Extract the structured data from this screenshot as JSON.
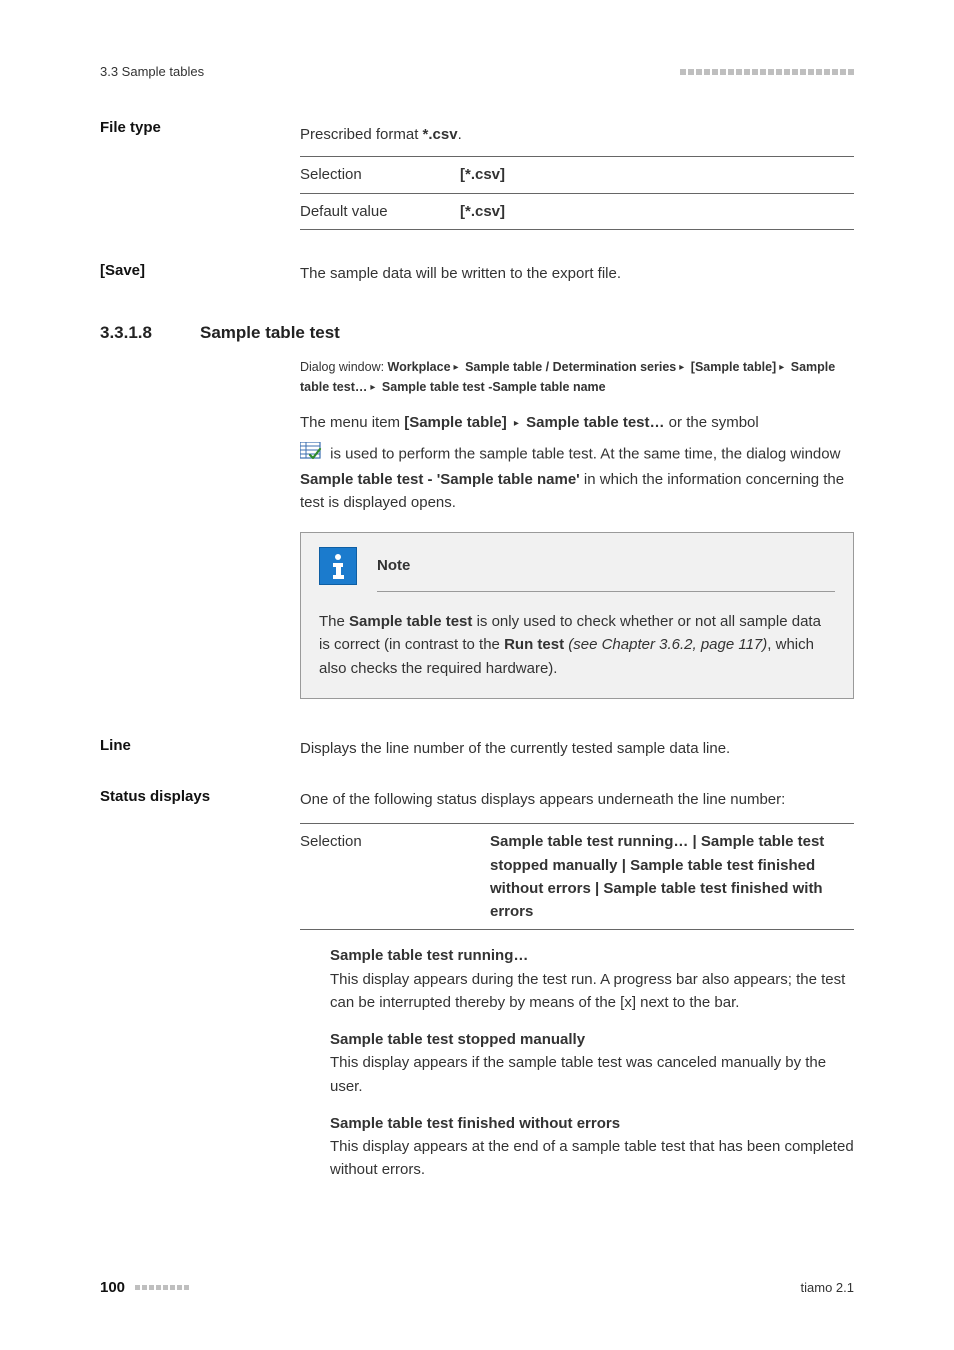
{
  "header": {
    "section": "3.3 Sample tables"
  },
  "file_type": {
    "label": "File type",
    "prescribed_prefix": "Prescribed format ",
    "prescribed_bold": "*.csv",
    "prescribed_suffix": ".",
    "rows": [
      {
        "k": "Selection",
        "v": "[*.csv]"
      },
      {
        "k": "Default value",
        "v": "[*.csv]"
      }
    ]
  },
  "save": {
    "label": "[Save]",
    "body": "The sample data will be written to the export file."
  },
  "h2": {
    "number": "3.3.1.8",
    "title": "Sample table test"
  },
  "breadcrumb": {
    "prefix": "Dialog window: ",
    "parts": [
      "Workplace",
      "Sample table / Determination series",
      "[Sample table]",
      "Sample table test…",
      "Sample table test -Sample table name"
    ]
  },
  "para1": {
    "a": "The menu item ",
    "b": "[Sample table]",
    "c_arrow": "▸",
    "d": "Sample table test…",
    "e": " or the symbol"
  },
  "para2": {
    "a": " is used to perform the sample table test. At the same time, the dialog window ",
    "b": "Sample table test - 'Sample table name'",
    "c": " in which the information concerning the test is displayed opens."
  },
  "note": {
    "title": "Note",
    "t1a": "The ",
    "t1b": "Sample table test",
    "t1c": " is only used to check whether or not all sample data is correct (in contrast to the ",
    "t1d": "Run test",
    "t1e_italic": " (see Chapter 3.6.2, page 117)",
    "t1f": ", which also checks the required hardware)."
  },
  "line": {
    "label": "Line",
    "body": "Displays the line number of the currently tested sample data line."
  },
  "status": {
    "label": "Status displays",
    "intro": "One of the following status displays appears underneath the line number:",
    "sel_label": "Selection",
    "sel_parts": [
      "Sample table test running…",
      "Sample table test stopped manually",
      "Sample table test finished without errors",
      "Sample table test finished with errors"
    ],
    "defs": [
      {
        "title": "Sample table test running…",
        "body": "This display appears during the test run. A progress bar also appears; the test can be interrupted thereby by means of the [x] next to the bar."
      },
      {
        "title": "Sample table test stopped manually",
        "body": "This display appears if the sample table test was canceled manually by the user."
      },
      {
        "title": "Sample table test finished without errors",
        "body": "This display appears at the end of a sample table test that has been completed without errors."
      }
    ]
  },
  "footer": {
    "page": "100",
    "product": "tiamo 2.1"
  }
}
